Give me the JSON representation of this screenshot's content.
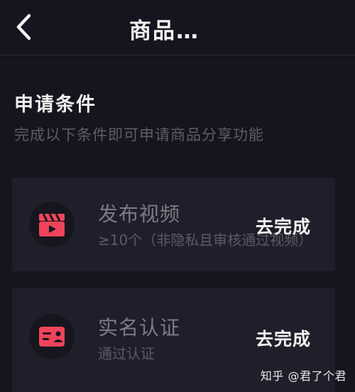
{
  "header": {
    "back_icon": "chevron-left-icon",
    "title": "商品…"
  },
  "section": {
    "title": "申请条件",
    "subtitle": "完成以下条件即可申请商品分享功能"
  },
  "conditions": [
    {
      "icon": "video-clapper-icon",
      "title": "发布视频",
      "description": "≥10个（非隐私且审核通过视频）",
      "action": "去完成"
    },
    {
      "icon": "id-card-icon",
      "title": "实名认证",
      "description": "通过认证",
      "action": "去完成"
    }
  ],
  "watermark": "知乎 @君了个君",
  "colors": {
    "background": "#15151f",
    "card": "#1f1f2b",
    "accent": "#f0445a"
  }
}
